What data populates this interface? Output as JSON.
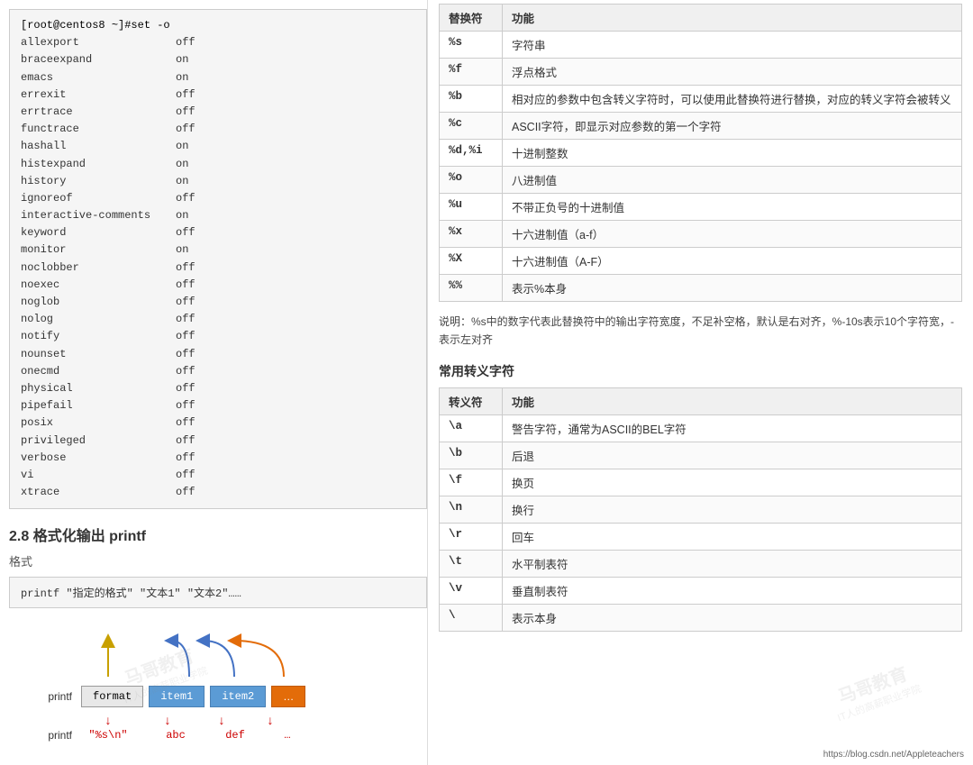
{
  "left": {
    "terminal": {
      "prompt": "[root@centos8 ~]#set -o",
      "rows": [
        {
          "key": "allexport",
          "val": "off"
        },
        {
          "key": "braceexpand",
          "val": "on"
        },
        {
          "key": "emacs",
          "val": "on"
        },
        {
          "key": "errexit",
          "val": "off"
        },
        {
          "key": "errtrace",
          "val": "off"
        },
        {
          "key": "functrace",
          "val": "off"
        },
        {
          "key": "hashall",
          "val": "on"
        },
        {
          "key": "histexpand",
          "val": "on"
        },
        {
          "key": "history",
          "val": "on"
        },
        {
          "key": "ignoreof",
          "val": "off"
        },
        {
          "key": "interactive-comments",
          "val": "on"
        },
        {
          "key": "keyword",
          "val": "off"
        },
        {
          "key": "monitor",
          "val": "on"
        },
        {
          "key": "noclobber",
          "val": "off"
        },
        {
          "key": "noexec",
          "val": "off"
        },
        {
          "key": "noglob",
          "val": "off"
        },
        {
          "key": "nolog",
          "val": "off"
        },
        {
          "key": "notify",
          "val": "off"
        },
        {
          "key": "nounset",
          "val": "off"
        },
        {
          "key": "onecmd",
          "val": "off"
        },
        {
          "key": "physical",
          "val": "off"
        },
        {
          "key": "pipefail",
          "val": "off"
        },
        {
          "key": "posix",
          "val": "off"
        },
        {
          "key": "privileged",
          "val": "off"
        },
        {
          "key": "verbose",
          "val": "off"
        },
        {
          "key": "vi",
          "val": "off"
        },
        {
          "key": "xtrace",
          "val": "off"
        }
      ]
    },
    "section_title": "2.8 格式化输出 printf",
    "subsection_format": "格式",
    "code": "printf \"指定的格式\" \"文本1\" \"文本2\"……",
    "diagram": {
      "printf_label": "printf",
      "format_box": "format",
      "item1_box": "item1",
      "item2_box": "item2",
      "dots_box": "…",
      "printf_label2": "printf",
      "fmt_val": "\"%s\\n\"",
      "abc_val": "abc",
      "def_val": "def",
      "ellipsis_val": "…"
    }
  },
  "right": {
    "table1": {
      "headers": [
        "替换符",
        "功能"
      ],
      "rows": [
        [
          "%s",
          "字符串"
        ],
        [
          "%f",
          "浮点格式"
        ],
        [
          "%b",
          "相对应的参数中包含转义字符时，可以使用此替换符进行替换，对应的转义字符会被转义"
        ],
        [
          "%c",
          "ASCII字符，即显示对应参数的第一个字符"
        ],
        [
          "%d,%i",
          "十进制整数"
        ],
        [
          "%o",
          "八进制值"
        ],
        [
          "%u",
          "不带正负号的十进制值"
        ],
        [
          "%x",
          "十六进制值（a-f）"
        ],
        [
          "%X",
          "十六进制值（A-F）"
        ],
        [
          "%%",
          "表示%本身"
        ]
      ]
    },
    "note": "说明：%s中的数字代表此替换符中的输出字符宽度，不足补空格，默认是右对齐，%-10s表示10个字符宽，-表示左对齐",
    "section2_title": "常用转义字符",
    "table2": {
      "headers": [
        "转义符",
        "功能"
      ],
      "rows": [
        [
          "\\a",
          "警告字符，通常为ASCII的BEL字符"
        ],
        [
          "\\b",
          "后退"
        ],
        [
          "\\f",
          "换页"
        ],
        [
          "\\n",
          "换行"
        ],
        [
          "\\r",
          "回车"
        ],
        [
          "\\t",
          "水平制表符"
        ],
        [
          "\\v",
          "垂直制表符"
        ],
        [
          "\\",
          "表示本身"
        ]
      ]
    },
    "watermark": {
      "line1": "马哥教育",
      "line2": "IT人的高薪职业学院"
    },
    "url": "https://blog.csdn.net/Appleteachers"
  }
}
